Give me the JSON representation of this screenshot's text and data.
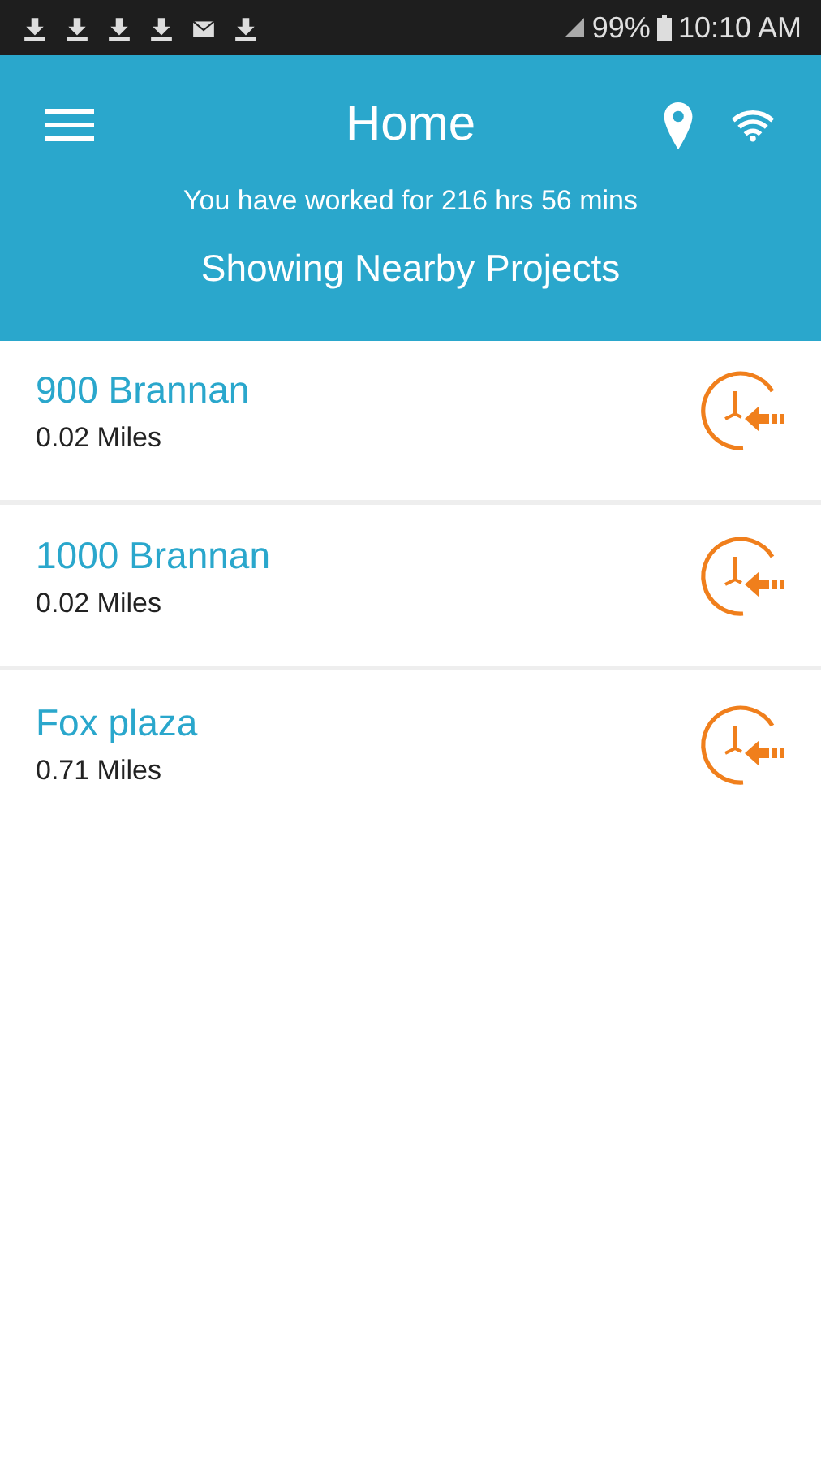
{
  "status_bar": {
    "battery": "99%",
    "time": "10:10 AM"
  },
  "app_bar": {
    "title": "Home",
    "worked": "You have worked for 216 hrs 56 mins",
    "subtitle": "Showing Nearby Projects"
  },
  "projects": [
    {
      "name": "900 Brannan",
      "distance": "0.02 Miles"
    },
    {
      "name": "1000 Brannan",
      "distance": "0.02 Miles"
    },
    {
      "name": "Fox plaza",
      "distance": "0.71 Miles"
    }
  ]
}
